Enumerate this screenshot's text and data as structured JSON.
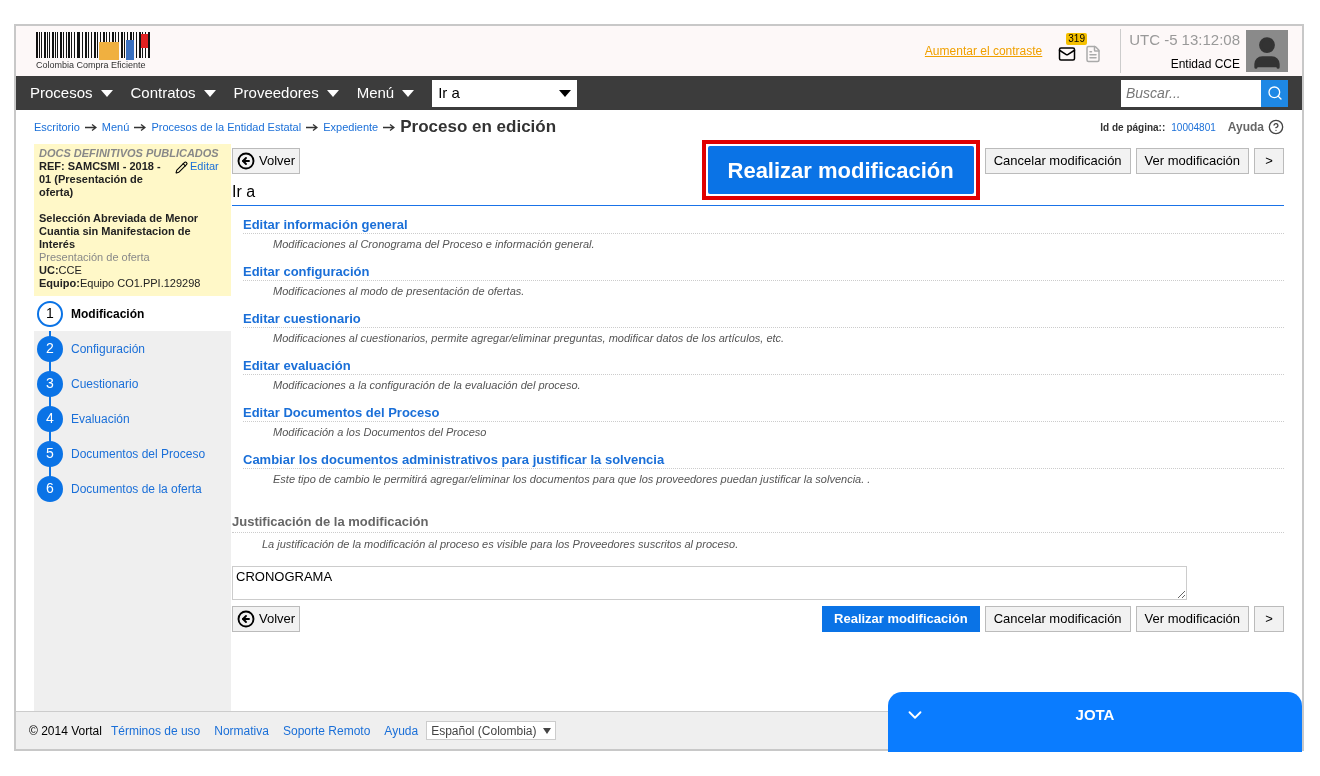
{
  "header": {
    "logo_text": "Colombia Compra Eficiente",
    "contrast_link": "Aumentar el contraste",
    "mail_count": "319",
    "timezone": "UTC -5",
    "time": "13:12:08",
    "user": "Entidad CCE"
  },
  "nav": {
    "menus": [
      "Procesos",
      "Contratos",
      "Proveedores",
      "Menú"
    ],
    "goto": "Ir a",
    "search_placeholder": "Buscar..."
  },
  "breadcrumb": {
    "links": [
      "Escritorio",
      "Menú",
      "Procesos de la Entidad Estatal",
      "Expediente"
    ],
    "current": "Proceso en edición",
    "page_id_label": "Id de página::",
    "page_id": "10004801",
    "help": "Ayuda"
  },
  "info": {
    "status": "DOCS DEFINITIVOS PUBLICADOS",
    "ref": "REF: SAMCSMI - 2018 - 01 (Presentación de oferta)",
    "edit": "Editar",
    "type": "Selección Abreviada de Menor Cuantia sin Manifestacion de Interés",
    "phase": "Presentación de oferta",
    "uc_label": "UC:",
    "uc": "CCE",
    "team_label": "Equipo:",
    "team": "Equipo CO1.PPI.129298"
  },
  "steps": [
    {
      "number": "1",
      "label": "Modificación",
      "selected": true
    },
    {
      "number": "2",
      "label": "Configuración",
      "selected": false
    },
    {
      "number": "3",
      "label": "Cuestionario",
      "selected": false
    },
    {
      "number": "4",
      "label": "Evaluación",
      "selected": false
    },
    {
      "number": "5",
      "label": "Documentos del Proceso",
      "selected": false
    },
    {
      "number": "6",
      "label": "Documentos de la oferta",
      "selected": false
    }
  ],
  "toolbar_top": {
    "back": "Volver",
    "primary": "Realizar modificación",
    "highlighted": true,
    "cancel": "Cancelar modificación",
    "view": "Ver modificación",
    "next": ">"
  },
  "section_title": "Ir a",
  "sections": [
    {
      "title": "Editar información general",
      "description": "Modificaciones al Cronograma del Proceso e información general."
    },
    {
      "title": "Editar configuración",
      "description": "Modificaciones al modo de presentación de ofertas."
    },
    {
      "title": "Editar cuestionario",
      "description": "Modificaciones al cuestionarios, permite agregar/eliminar preguntas, modificar datos de los artículos, etc."
    },
    {
      "title": "Editar evaluación",
      "description": "Modificaciones a la configuración de la evaluación del proceso."
    },
    {
      "title": "Editar Documentos del Proceso",
      "description": "Modificación a los Documentos del Proceso"
    },
    {
      "title": "Cambiar los documentos administrativos para justificar la solvencia",
      "description": "Este tipo de cambio le permitirá agregar/eliminar los documentos para que los proveedores puedan justificar la solvencia. ."
    }
  ],
  "justification": {
    "title": "Justificación de la modificación",
    "description": "La justificación de la modificación al proceso es visible para los Proveedores suscritos al proceso.",
    "value": "CRONOGRAMA"
  },
  "toolbar_bottom": {
    "back": "Volver",
    "primary": "Realizar modificación",
    "highlighted": false,
    "cancel": "Cancelar modificación",
    "view": "Ver modificación",
    "next": ">"
  },
  "footer": {
    "copyright": "© 2014 Vortal",
    "links": [
      "Términos de uso",
      "Normativa",
      "Soporte Remoto",
      "Ayuda"
    ],
    "language": "Español (Colombia)"
  },
  "chat": {
    "title": "JOTA"
  }
}
